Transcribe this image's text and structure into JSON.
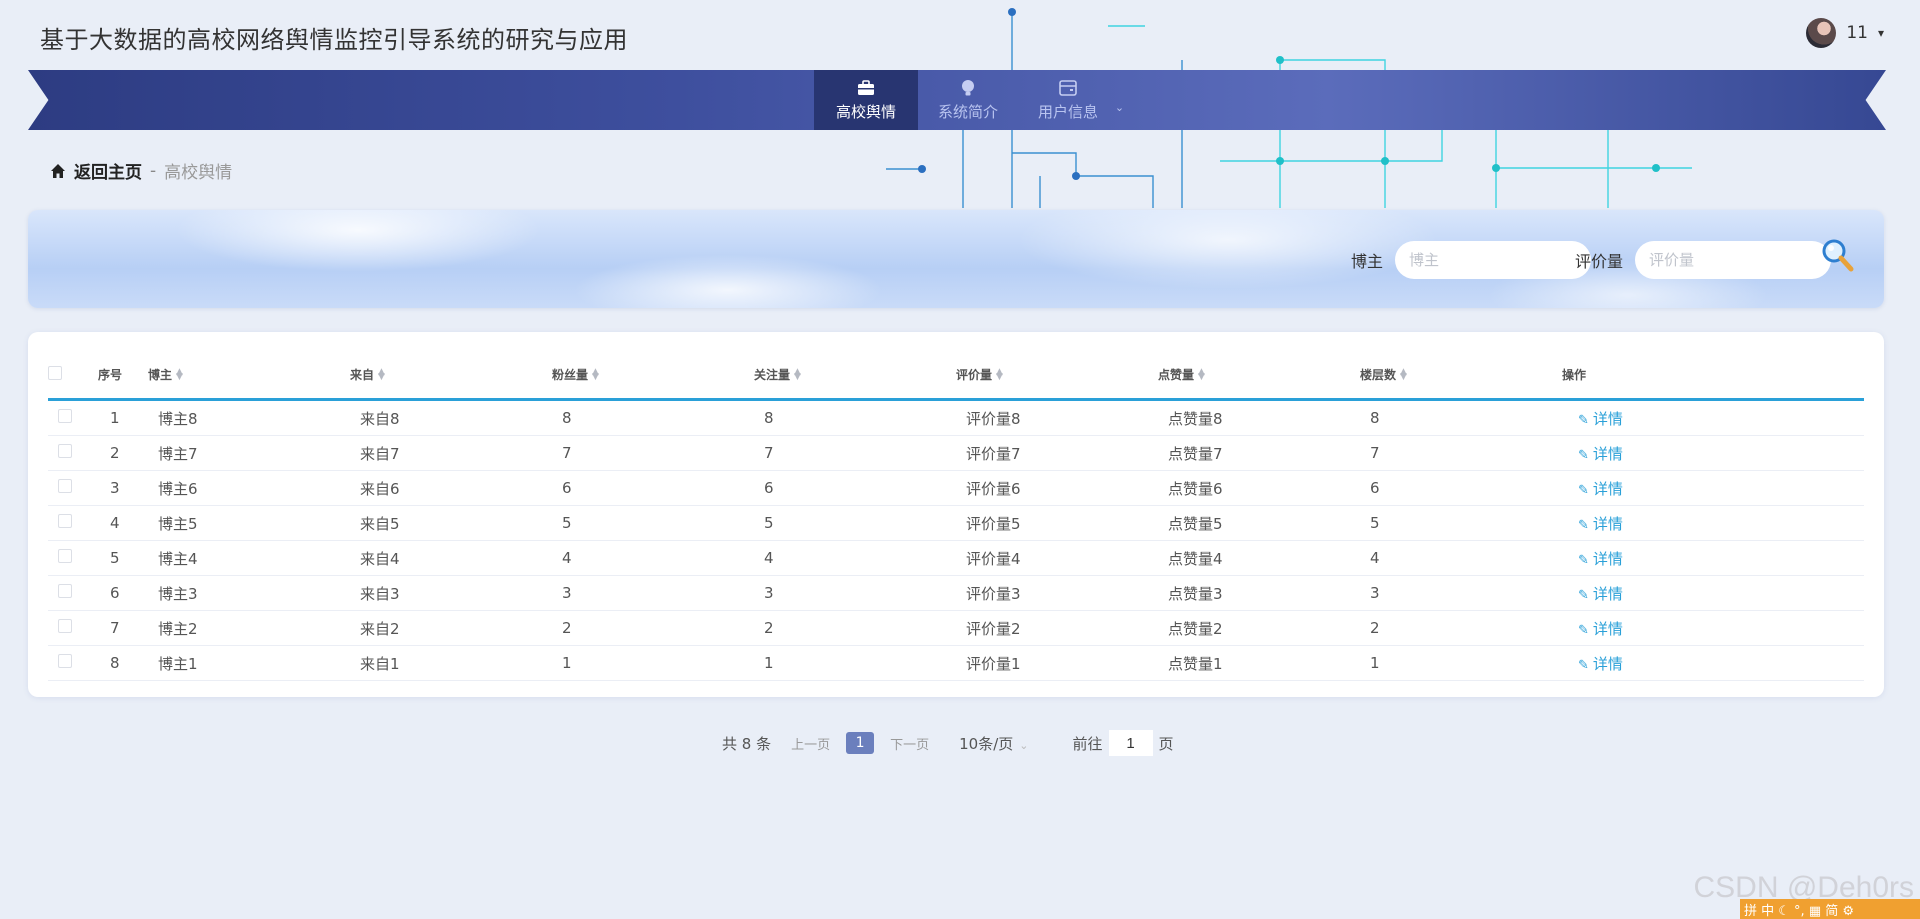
{
  "app": {
    "title": "基于大数据的高校网络舆情监控引导系统的研究与应用"
  },
  "user": {
    "name": "11",
    "caret": "▾"
  },
  "nav": {
    "items": [
      {
        "label": "高校舆情",
        "icon": "briefcase-icon",
        "active": true
      },
      {
        "label": "系统简介",
        "icon": "bulb-icon",
        "active": false
      },
      {
        "label": "用户信息",
        "icon": "wallet-icon",
        "active": false,
        "has_submenu": true
      }
    ],
    "submenu_caret": "⌄"
  },
  "breadcrumb": {
    "home": "返回主页",
    "separator": "-",
    "current": "高校舆情"
  },
  "search": {
    "fields": [
      {
        "label": "博主",
        "placeholder": "博主",
        "value": ""
      },
      {
        "label": "评价量",
        "placeholder": "评价量",
        "value": ""
      }
    ],
    "button_icon": "magnifier-icon"
  },
  "table": {
    "columns": [
      "序号",
      "博主",
      "来自",
      "粉丝量",
      "关注量",
      "评价量",
      "点赞量",
      "楼层数",
      "操作"
    ],
    "rows": [
      [
        "1",
        "博主8",
        "来自8",
        "8",
        "8",
        "评价量8",
        "点赞量8",
        "8",
        "详情"
      ],
      [
        "2",
        "博主7",
        "来自7",
        "7",
        "7",
        "评价量7",
        "点赞量7",
        "7",
        "详情"
      ],
      [
        "3",
        "博主6",
        "来自6",
        "6",
        "6",
        "评价量6",
        "点赞量6",
        "6",
        "详情"
      ],
      [
        "4",
        "博主5",
        "来自5",
        "5",
        "5",
        "评价量5",
        "点赞量5",
        "5",
        "详情"
      ],
      [
        "5",
        "博主4",
        "来自4",
        "4",
        "4",
        "评价量4",
        "点赞量4",
        "4",
        "详情"
      ],
      [
        "6",
        "博主3",
        "来自3",
        "3",
        "3",
        "评价量3",
        "点赞量3",
        "3",
        "详情"
      ],
      [
        "7",
        "博主2",
        "来自2",
        "2",
        "2",
        "评价量2",
        "点赞量2",
        "2",
        "详情"
      ],
      [
        "8",
        "博主1",
        "来自1",
        "1",
        "1",
        "评价量1",
        "点赞量1",
        "1",
        "详情"
      ]
    ]
  },
  "pagination": {
    "total": "共 8 条",
    "prev": "上一页",
    "current_page": "1",
    "next": "下一页",
    "page_size": "10条/页",
    "goto_label": "前往",
    "goto_value": "1",
    "goto_suffix": "页"
  },
  "watermark": "CSDN @Deh0rs",
  "ime_bar": "拼 中 ☾ °, ▦ 简 ⚙",
  "colors": {
    "nav_dark": "#283571",
    "accent": "#2aa0d8",
    "page_bg": "#e9eef7",
    "pager_active": "#6b7fbd"
  }
}
